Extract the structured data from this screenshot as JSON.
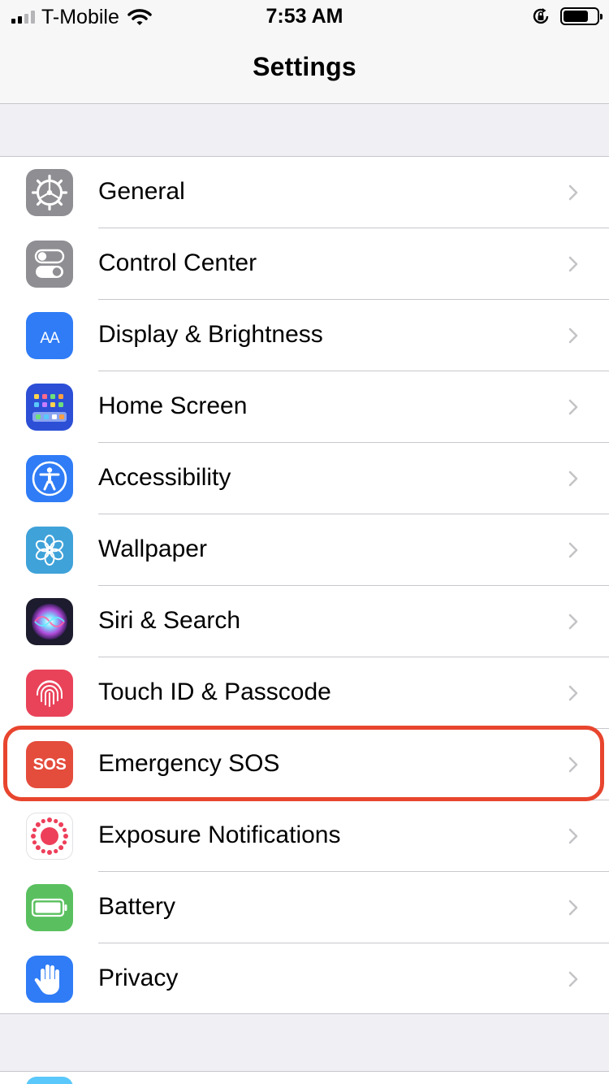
{
  "status_bar": {
    "carrier": "T-Mobile",
    "time": "7:53 AM",
    "battery_level_percent": 74,
    "signal_bars_active": 2,
    "signal_bars_total": 4
  },
  "nav": {
    "title": "Settings"
  },
  "settings_items": [
    {
      "label": "General",
      "icon": "gear-icon",
      "icon_color": "#8e8e93"
    },
    {
      "label": "Control Center",
      "icon": "toggles-icon",
      "icon_color": "#8e8e93"
    },
    {
      "label": "Display & Brightness",
      "icon": "text-size-icon",
      "icon_color": "#2f7cf6",
      "icon_text": "AA"
    },
    {
      "label": "Home Screen",
      "icon": "app-grid-icon",
      "icon_color": "#2c4fd6"
    },
    {
      "label": "Accessibility",
      "icon": "accessibility-person-icon",
      "icon_color": "#2f7cf6"
    },
    {
      "label": "Wallpaper",
      "icon": "flower-icon",
      "icon_color": "#3fa2d9"
    },
    {
      "label": "Siri & Search",
      "icon": "siri-icon",
      "icon_color": "#1c1c2e"
    },
    {
      "label": "Touch ID & Passcode",
      "icon": "fingerprint-icon",
      "icon_color": "#e9435a"
    },
    {
      "label": "Emergency SOS",
      "icon": "sos-icon",
      "icon_color": "#e44c3c",
      "icon_text": "SOS",
      "highlighted": true
    },
    {
      "label": "Exposure Notifications",
      "icon": "exposure-icon",
      "icon_color": "#ffffff"
    },
    {
      "label": "Battery",
      "icon": "battery-icon",
      "icon_color": "#5ac05f"
    },
    {
      "label": "Privacy",
      "icon": "hand-icon",
      "icon_color": "#2f7cf6"
    }
  ],
  "highlight_color": "#e8452e"
}
